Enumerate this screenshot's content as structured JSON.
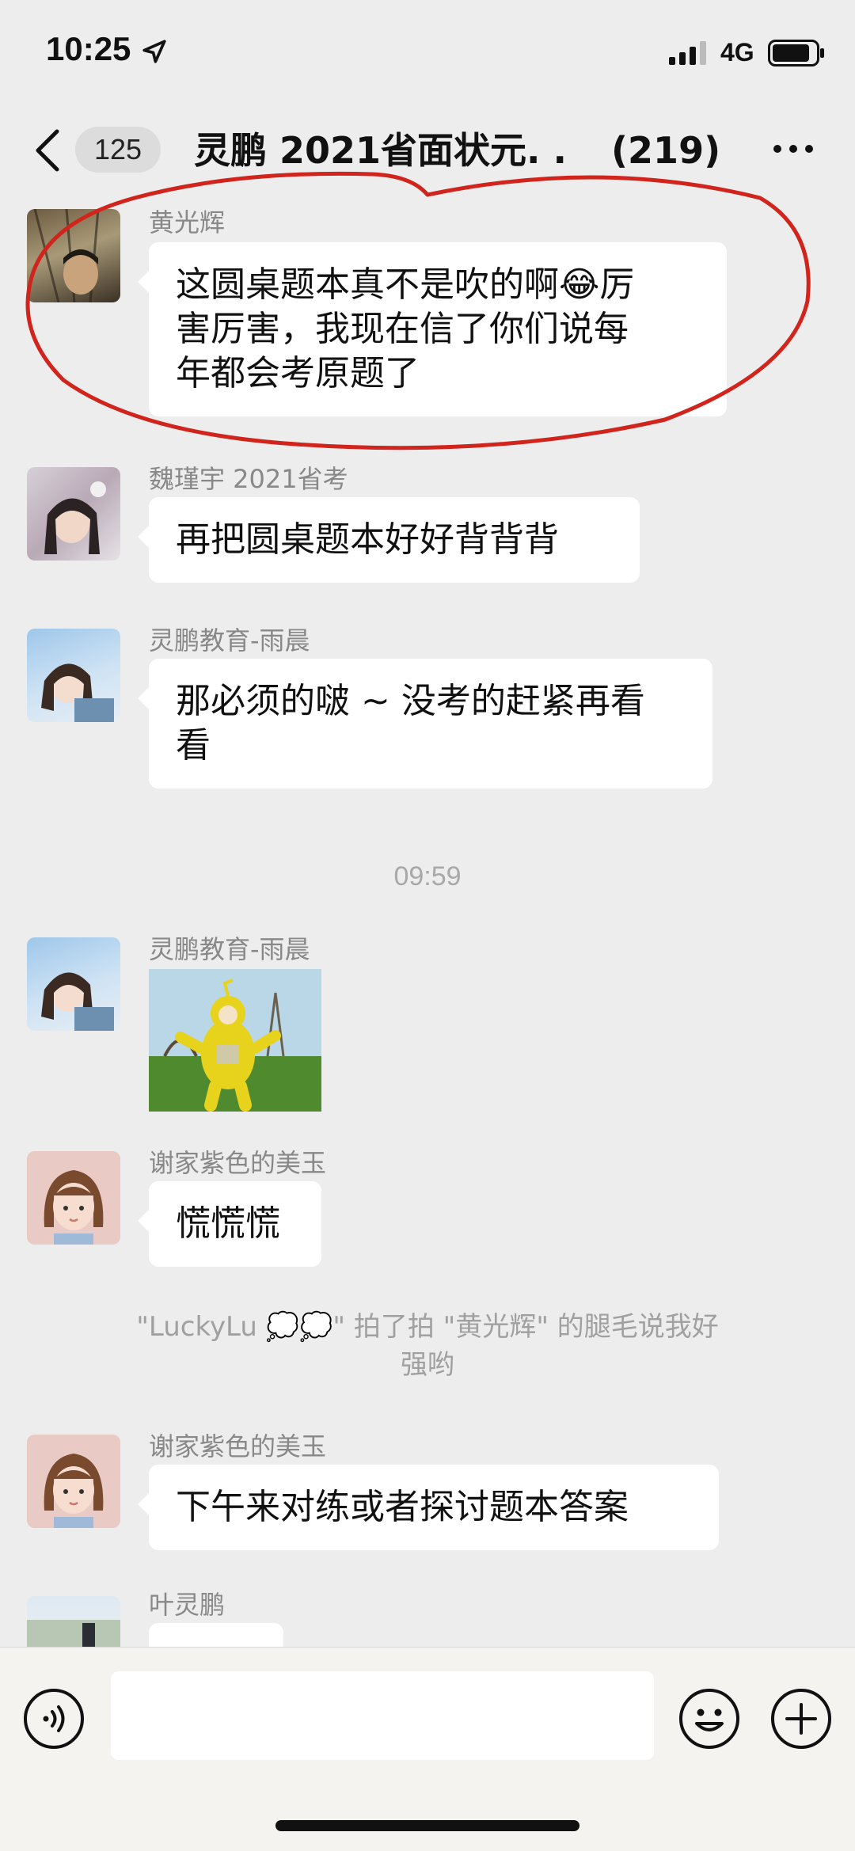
{
  "status_bar": {
    "time": "10:25",
    "network": "4G"
  },
  "header": {
    "unread_count": "125",
    "title": "灵鹏 2021省面状元. .",
    "member_count": "(219)"
  },
  "messages": [
    {
      "sender": "黄光辉",
      "text_lines": [
        "这圆桌题本真不是吹的啊",
        "害厉害，我现在信了你们说每",
        "年都会考原题了"
      ],
      "emoji": "😂",
      "emoji_suffix": "厉"
    },
    {
      "sender": "魏瑾宇 2021省考",
      "text": "再把圆桌题本好好背背背"
    },
    {
      "sender": "灵鹏教育-雨晨",
      "text_lines": [
        "那必须的啵 ~ 没考的赶紧再看",
        "看"
      ]
    },
    {
      "time_separator": "09:59"
    },
    {
      "sender": "灵鹏教育-雨晨",
      "image": "yellow-teletubby-sticker"
    },
    {
      "sender": "谢家紫色的美玉",
      "text": "慌慌慌"
    },
    {
      "system_lines": [
        "\"LuckyLu 💭💭\" 拍了拍 \"黄光辉\" 的腿毛说我好",
        "强哟"
      ]
    },
    {
      "sender": "谢家紫色的美玉",
      "text": "下午来对练或者探讨题本答案"
    },
    {
      "sender": "叶灵鹏"
    }
  ],
  "colors": {
    "background": "#ededed",
    "bubble": "#ffffff",
    "annotation_circle": "#d0241c"
  },
  "icons": {
    "voice": "voice-icon",
    "emoji": "emoji-icon",
    "plus": "plus-icon",
    "back": "chevron-left-icon",
    "more": "more-icon"
  }
}
